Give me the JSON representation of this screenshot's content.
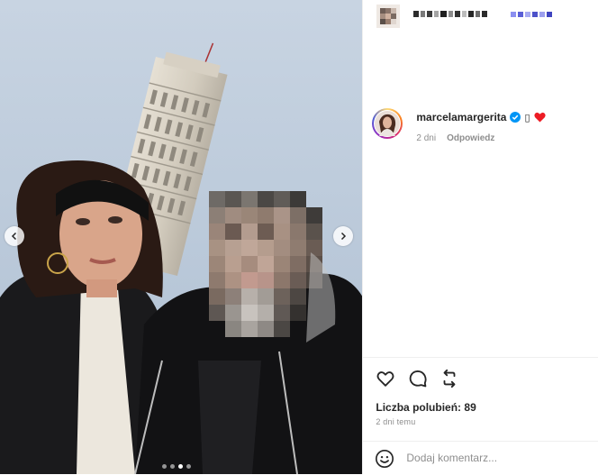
{
  "post": {
    "author_handle_pixelated": "",
    "author_status_pixelated": ""
  },
  "comment": {
    "username": "marcelamargerita",
    "verified": true,
    "emoji_box": "▯",
    "heart_color": "#ed1c24",
    "time": "2 dni",
    "reply_label": "Odpowiedz"
  },
  "actions": {
    "icons": [
      "heart-outline-icon",
      "comment-bubble-icon",
      "share-arrows-icon"
    ]
  },
  "likes_label": "Liczba polubień: 89",
  "posted_time": "2 dni temu",
  "add_comment": {
    "placeholder": "Dodaj komentarz..."
  },
  "carousel": {
    "slide_count": 4,
    "active_index": 2
  },
  "colors": {
    "verified_badge": "#0095f6",
    "meta_text": "#8e8e8e",
    "text": "#262626"
  }
}
